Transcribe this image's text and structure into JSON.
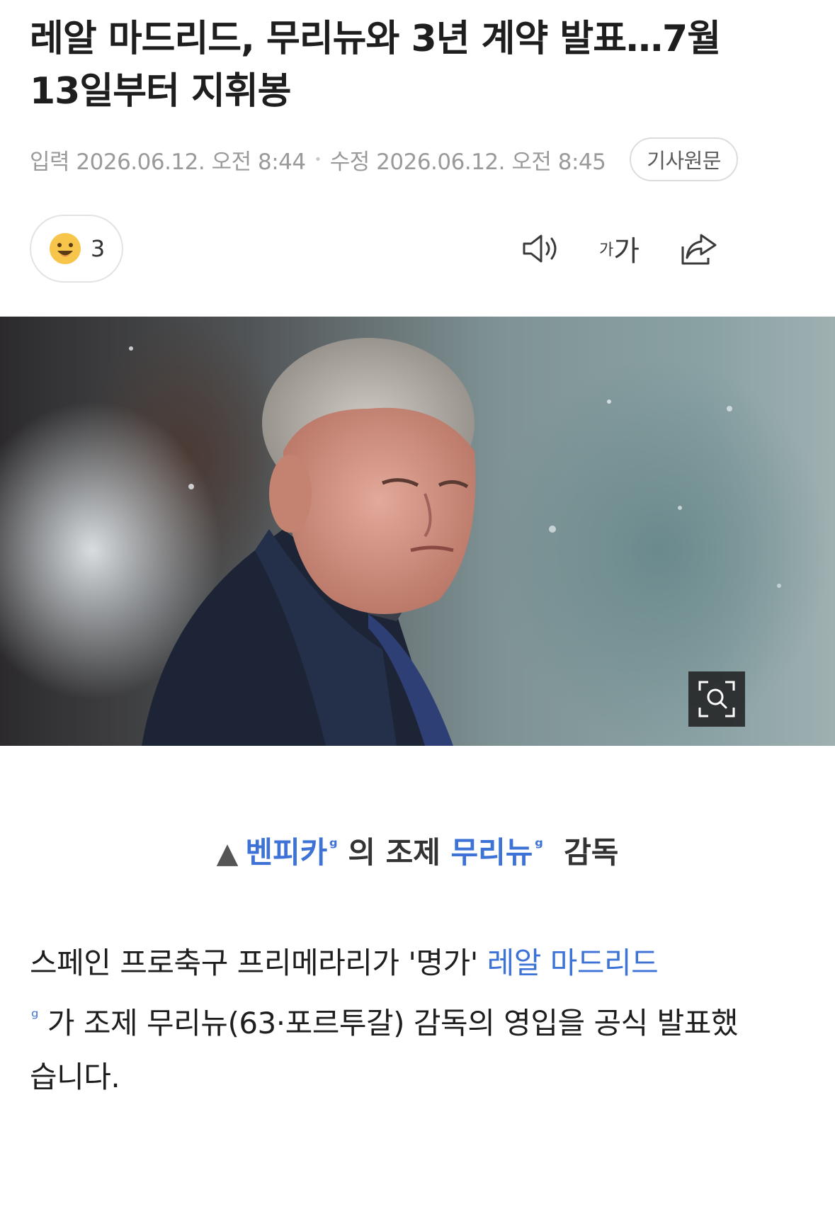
{
  "article": {
    "title": "레알 마드리드, 무리뉴와 3년 계약 발표…7월 13일부터 지휘봉",
    "meta": {
      "published_label": "입력",
      "published": "2026.06.12. 오전 8:44",
      "modified_label": "수정",
      "modified": "2026.06.12. 오전 8:45",
      "original_button": "기사원문"
    },
    "reaction": {
      "icon": "smile-emoji-icon",
      "count": "3"
    },
    "toolbar": {
      "tts_icon": "speaker-icon",
      "font_small": "가",
      "font_large": "가",
      "share_icon": "share-icon"
    },
    "photo": {
      "zoom_icon": "zoom-search-icon"
    },
    "caption": {
      "prefix": "▲",
      "link1": "벤피카",
      "middle": "의 조제",
      "link2": "무리뉴",
      "suffix": "감독"
    },
    "body": {
      "part1": "스페인 프로축구 프리메라리가 '명가' ",
      "link": "레알 마드리드",
      "part2": " 가 조제 무리뉴(63·포르투갈) 감독의 영입을 공식 발표했습니다."
    },
    "link_marker": "ᵍ",
    "colors": {
      "link": "#3d72d6",
      "meta": "#9a9a9a",
      "title": "#1e1e1e"
    }
  }
}
